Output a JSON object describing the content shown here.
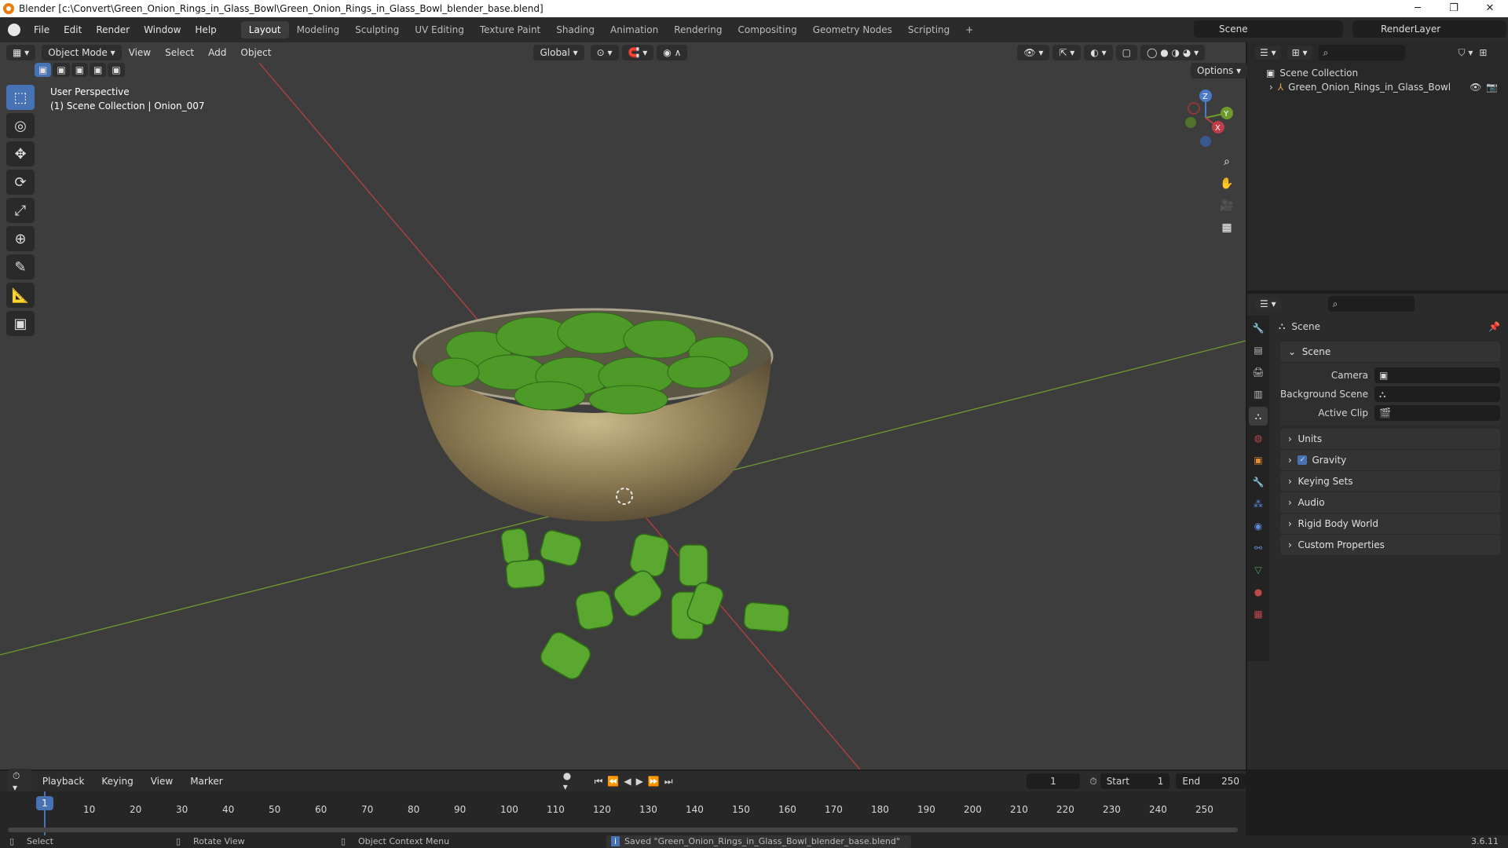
{
  "titlebar": {
    "title": "Blender [c:\\Convert\\Green_Onion_Rings_in_Glass_Bowl\\Green_Onion_Rings_in_Glass_Bowl_blender_base.blend]",
    "minimize": "─",
    "maximize": "❐",
    "close": "✕"
  },
  "menu": {
    "items": [
      "File",
      "Edit",
      "Render",
      "Window",
      "Help"
    ],
    "workspaces": [
      "Layout",
      "Modeling",
      "Sculpting",
      "UV Editing",
      "Texture Paint",
      "Shading",
      "Animation",
      "Rendering",
      "Compositing",
      "Geometry Nodes",
      "Scripting"
    ],
    "active_workspace": "Layout",
    "add_workspace": "+",
    "scene": "Scene",
    "view_layer": "RenderLayer"
  },
  "viewport_header": {
    "mode": "Object Mode",
    "menus": [
      "View",
      "Select",
      "Add",
      "Object"
    ],
    "orientation": "Global",
    "options": "Options"
  },
  "viewport": {
    "perspective": "User Perspective",
    "collection_info": "(1) Scene Collection | Onion_007",
    "gizmo": {
      "z": "Z",
      "y": "Y",
      "x": "X"
    }
  },
  "tools": [
    {
      "name": "select-box-tool",
      "glyph": "⬚",
      "active": true
    },
    {
      "name": "cursor-tool",
      "glyph": "◎",
      "active": false
    },
    {
      "name": "move-tool",
      "glyph": "✥",
      "active": false
    },
    {
      "name": "rotate-tool",
      "glyph": "⟳",
      "active": false
    },
    {
      "name": "scale-tool",
      "glyph": "⤢",
      "active": false
    },
    {
      "name": "transform-tool",
      "glyph": "⊕",
      "active": false
    },
    {
      "name": "annotate-tool",
      "glyph": "✎",
      "active": false
    },
    {
      "name": "measure-tool",
      "glyph": "📐",
      "active": false
    },
    {
      "name": "add-cube-tool",
      "glyph": "▣",
      "active": false
    }
  ],
  "outliner": {
    "root": "Scene Collection",
    "items": [
      {
        "label": "Green_Onion_Rings_in_Glass_Bowl"
      }
    ]
  },
  "properties": {
    "title": "Scene",
    "panel_title": "Scene",
    "fields": [
      {
        "label": "Camera",
        "value": ""
      },
      {
        "label": "Background Scene",
        "value": ""
      },
      {
        "label": "Active Clip",
        "value": ""
      }
    ],
    "panels": [
      "Units",
      "Gravity",
      "Keying Sets",
      "Audio",
      "Rigid Body World",
      "Custom Properties"
    ],
    "gravity_checked": true
  },
  "timeline": {
    "menus": [
      "Playback",
      "Keying",
      "View",
      "Marker"
    ],
    "current_frame": "1",
    "start_label": "Start",
    "start": "1",
    "end_label": "End",
    "end": "250",
    "ticks": [
      "1",
      "10",
      "20",
      "30",
      "40",
      "50",
      "60",
      "70",
      "80",
      "90",
      "100",
      "110",
      "120",
      "130",
      "140",
      "150",
      "160",
      "170",
      "180",
      "190",
      "200",
      "210",
      "220",
      "230",
      "240",
      "250"
    ]
  },
  "statusbar": {
    "select": "Select",
    "rotate": "Rotate View",
    "context": "Object Context Menu",
    "message": "Saved \"Green_Onion_Rings_in_Glass_Bowl_blender_base.blend\"",
    "version": "3.6.11"
  },
  "colors": {
    "accent": "#4772b3",
    "x_axis": "#b8403f",
    "y_axis": "#6f9a2e",
    "onion": "#4e9a28",
    "frame_indicator": "#4772b3"
  }
}
